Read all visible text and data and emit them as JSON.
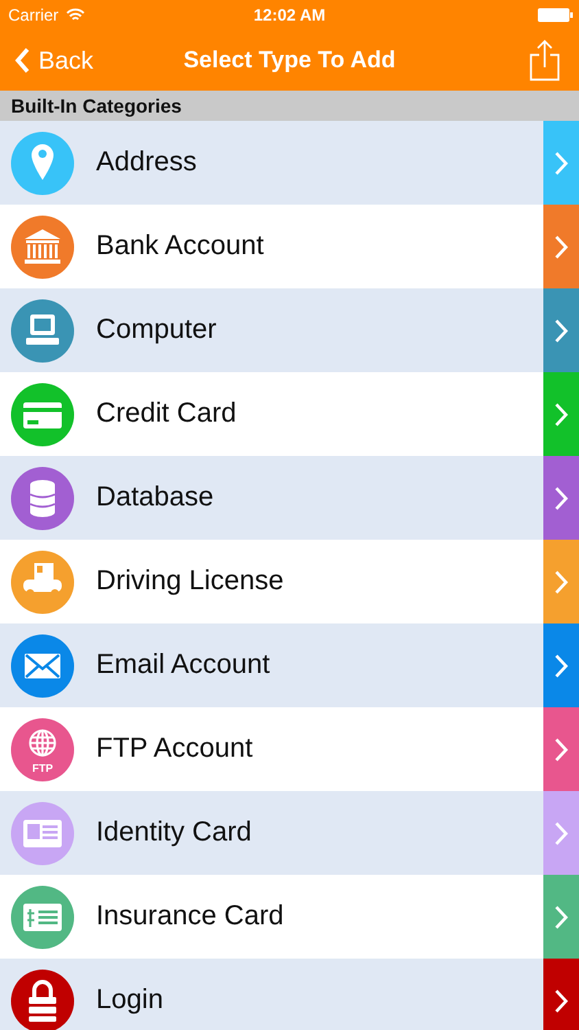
{
  "status_bar": {
    "carrier": "Carrier",
    "time": "12:02 AM"
  },
  "nav": {
    "back": "Back",
    "title": "Select Type To Add"
  },
  "section": {
    "title": "Built-In Categories"
  },
  "categories": [
    {
      "label": "Address",
      "kind": "pin",
      "color": "#38c3f8"
    },
    {
      "label": "Bank Account",
      "kind": "bank",
      "color": "#f07a2a"
    },
    {
      "label": "Computer",
      "kind": "computer",
      "color": "#3a94b4"
    },
    {
      "label": "Credit Card",
      "kind": "card",
      "color": "#12c12a"
    },
    {
      "label": "Database",
      "kind": "database",
      "color": "#a25fd2"
    },
    {
      "label": "Driving License",
      "kind": "license",
      "color": "#f5a02e"
    },
    {
      "label": "Email Account",
      "kind": "envelope",
      "color": "#0a88e8"
    },
    {
      "label": "FTP Account",
      "kind": "globe",
      "color": "#e8568e",
      "badge": "FTP"
    },
    {
      "label": "Identity Card",
      "kind": "idcard",
      "color": "#c8a6f4"
    },
    {
      "label": "Insurance Card",
      "kind": "insurance",
      "color": "#52b884"
    },
    {
      "label": "Login",
      "kind": "lock",
      "color": "#c00000"
    }
  ]
}
